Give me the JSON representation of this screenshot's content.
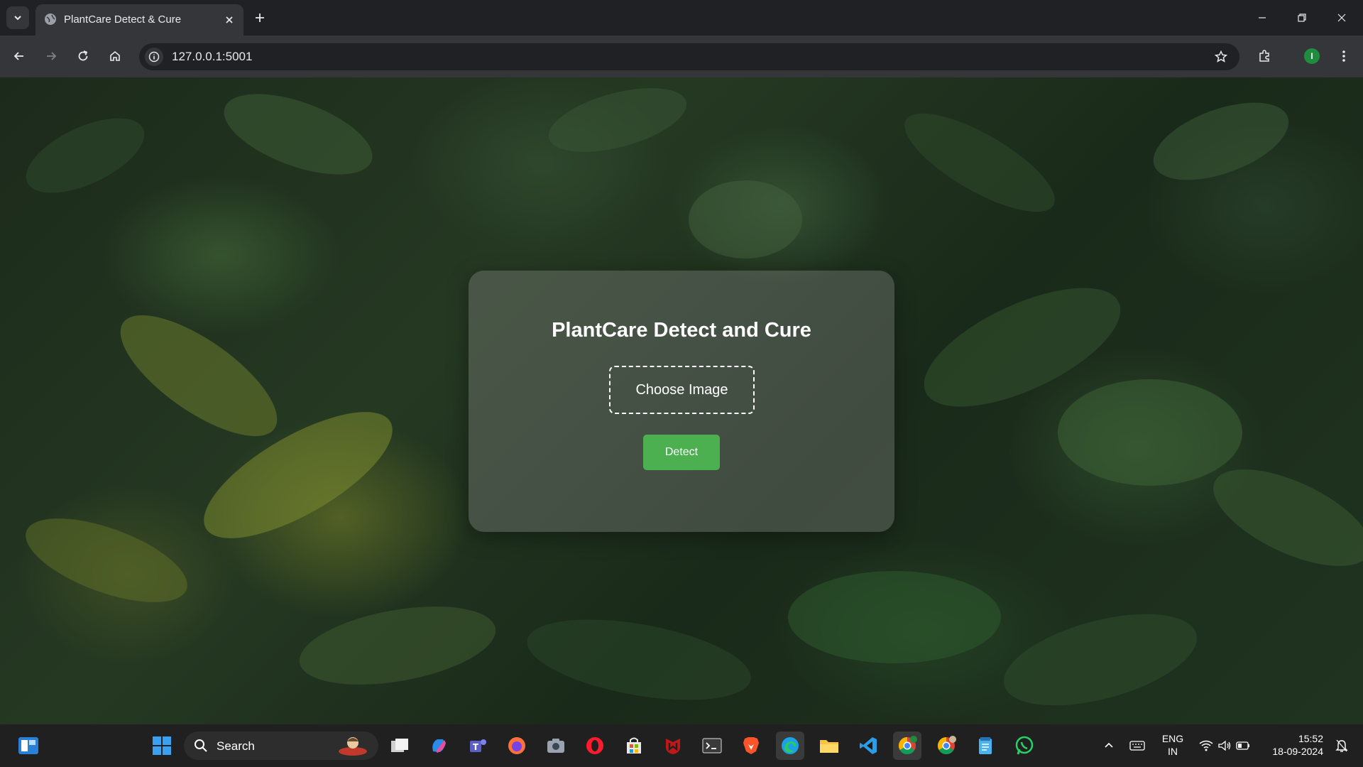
{
  "browser": {
    "tab_title": "PlantCare Detect & Cure",
    "url": "127.0.0.1:5001",
    "profile_initial": "I"
  },
  "page": {
    "title": "PlantCare Detect and Cure",
    "choose_label": "Choose Image",
    "detect_label": "Detect",
    "detect_color": "#4caf50"
  },
  "taskbar": {
    "search_label": "Search",
    "lang_line1": "ENG",
    "lang_line2": "IN",
    "time": "15:52",
    "date": "18-09-2024"
  }
}
